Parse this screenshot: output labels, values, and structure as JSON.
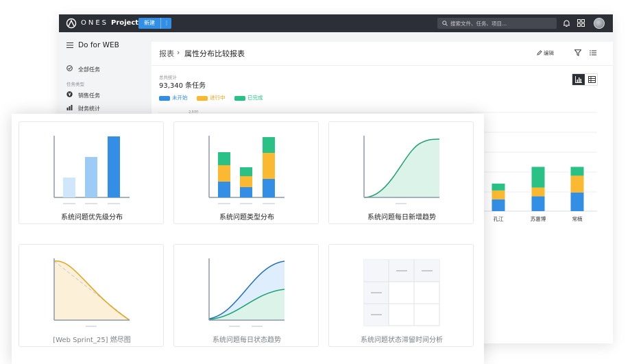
{
  "topbar": {
    "brand": "ONES",
    "product": "Project",
    "new_button": "新建",
    "more_button": "⋮",
    "search_placeholder": "搜索文件、任务、项目..."
  },
  "sidebar": {
    "project_name": "Do for WEB",
    "all_tasks": "全部任务",
    "group_label": "任务类型",
    "items": [
      {
        "label": "销售任务",
        "icon": "yen-icon"
      },
      {
        "label": "财务统计",
        "icon": "bar-chart-icon"
      }
    ]
  },
  "panel": {
    "breadcrumb_root": "报表",
    "breadcrumb_sep": "›",
    "breadcrumb_page": "属性分布比较报表",
    "edit_label": "编辑",
    "stat_label": "总共统计",
    "stat_value": "93,340 条任务",
    "legend": [
      {
        "label": "未开始",
        "color": "#338fe5"
      },
      {
        "label": "进行中",
        "color": "#fbb931"
      },
      {
        "label": "已完成",
        "color": "#2ac186"
      }
    ],
    "y_tick_partial": "2,500"
  },
  "chart_data": {
    "type": "bar",
    "categories": [
      "孔江",
      "苏惠博",
      "常楠"
    ],
    "series": [
      {
        "name": "未开始",
        "values": [
          600,
          750,
          950
        ]
      },
      {
        "name": "进行中",
        "values": [
          450,
          450,
          850
        ]
      },
      {
        "name": "已完成",
        "values": [
          350,
          1050,
          450
        ]
      }
    ]
  },
  "cards": [
    {
      "title": "系统问题优先级分布",
      "kind": "bar"
    },
    {
      "title": "系统问题类型分布",
      "kind": "stacked"
    },
    {
      "title": "系统问题每日新增趋势",
      "kind": "area"
    },
    {
      "title": "[Web Sprint_25] 燃尽图",
      "kind": "burndown"
    },
    {
      "title": "系统问题每日状态趋势",
      "kind": "cumulative"
    },
    {
      "title": "系统问题状态滞留时间分析",
      "kind": "table"
    }
  ],
  "colors": {
    "blue": "#338fe5",
    "light_blue": "#9ccbf5",
    "yellow": "#fbb931",
    "green": "#2ac186",
    "topbar": "#2c2f35"
  }
}
